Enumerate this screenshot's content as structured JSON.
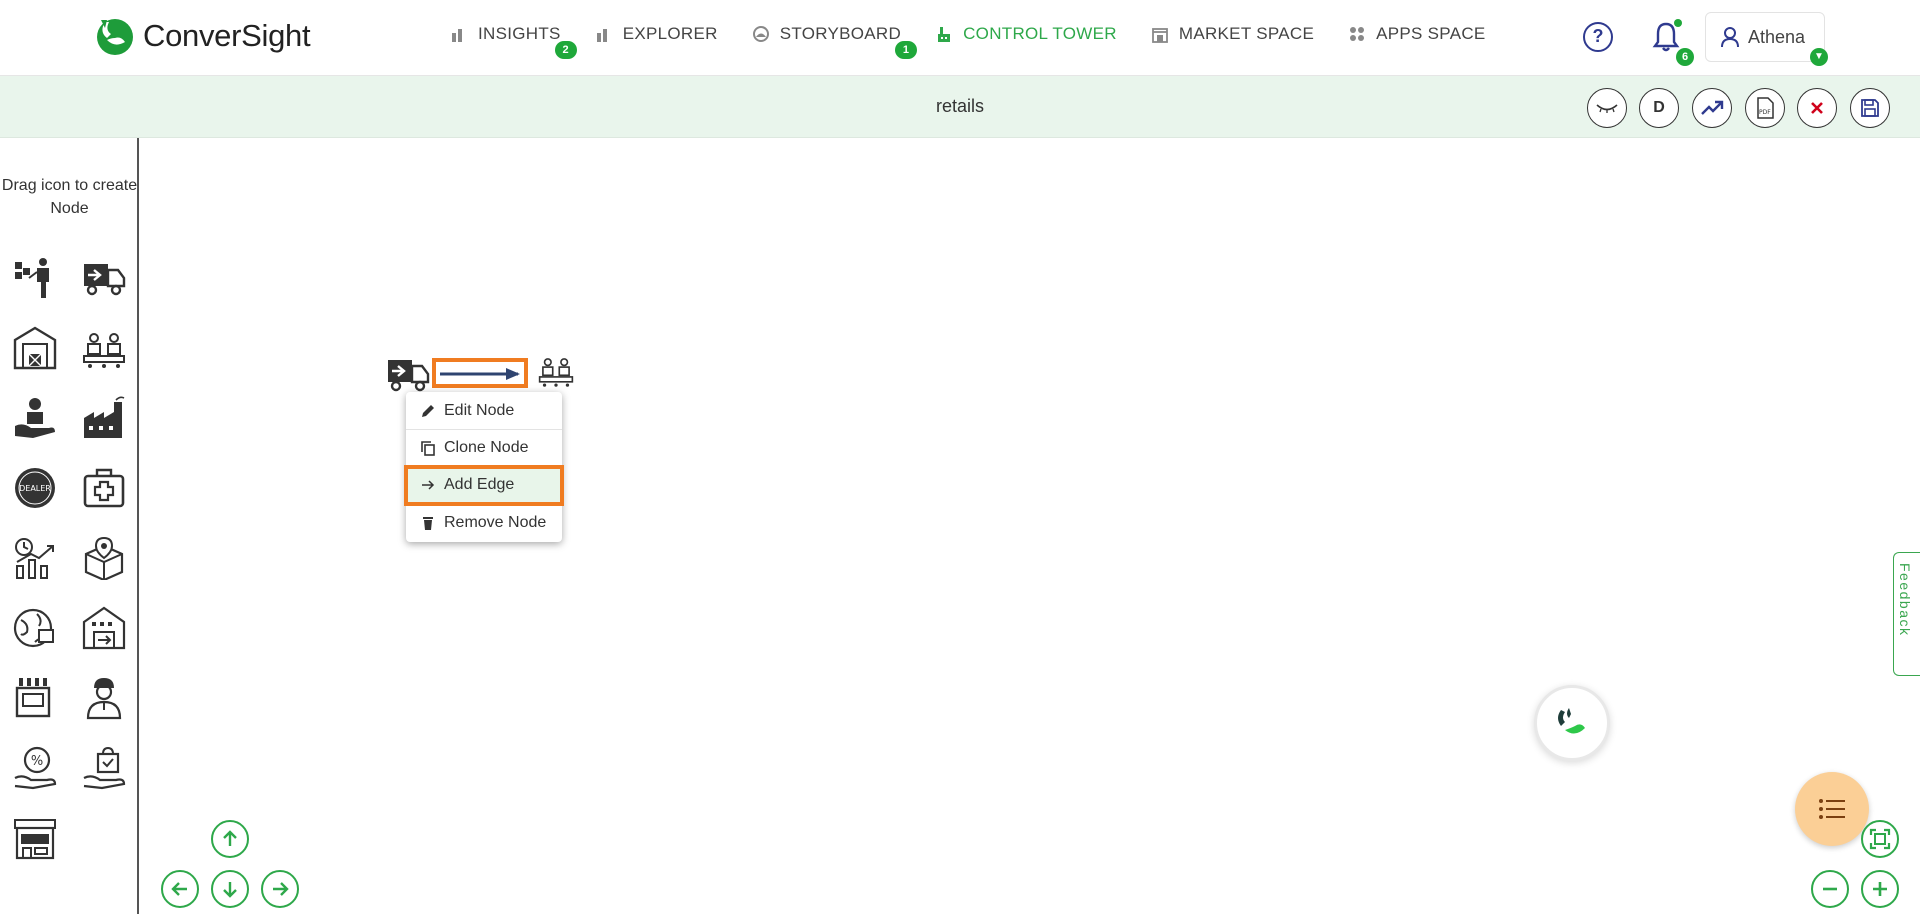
{
  "app": {
    "name": "ConverSight"
  },
  "nav": [
    {
      "label": "INSIGHTS",
      "badge": "2",
      "icon": "bar-chart-icon"
    },
    {
      "label": "EXPLORER",
      "badge": "",
      "icon": "bar-chart-icon"
    },
    {
      "label": "STORYBOARD",
      "badge": "1",
      "icon": "storyboard-icon"
    },
    {
      "label": "CONTROL TOWER",
      "badge": "",
      "icon": "tower-icon"
    },
    {
      "label": "MARKET SPACE",
      "badge": "",
      "icon": "market-icon"
    },
    {
      "label": "APPS SPACE",
      "badge": "",
      "icon": "grid-icon"
    }
  ],
  "header": {
    "help": "?",
    "notifications_count": "6",
    "user": "Athena"
  },
  "subheader": {
    "title": "retails",
    "tools": [
      {
        "name": "hide-icon"
      },
      {
        "name": "d-button",
        "label": "D"
      },
      {
        "name": "trend-icon"
      },
      {
        "name": "pdf-icon"
      },
      {
        "name": "close-icon"
      },
      {
        "name": "save-icon"
      }
    ]
  },
  "palette": {
    "title": "Drag icon to create Node",
    "icons": [
      "supplier-icon",
      "delivery-truck-icon",
      "warehouse-icon",
      "production-line-icon",
      "customer-care-icon",
      "factory-icon",
      "dealer-icon",
      "medical-kit-icon",
      "growth-icon",
      "package-location-icon",
      "global-logistics-icon",
      "distribution-center-icon",
      "machine-icon",
      "worker-icon",
      "discount-icon",
      "shopping-bag-icon",
      "store-icon"
    ]
  },
  "context_menu": {
    "items": [
      {
        "label": "Edit Node",
        "icon": "pencil-icon"
      },
      {
        "label": "Clone Node",
        "icon": "copy-icon"
      },
      {
        "label": "Add Edge",
        "icon": "arrow-right-icon"
      },
      {
        "label": "Remove Node",
        "icon": "trash-icon"
      }
    ]
  },
  "feedback": {
    "label": "Feedback"
  },
  "colors": {
    "accent": "#2ea84a",
    "highlight": "#f07c21",
    "subheader_bg": "#e9f5ec",
    "fab_bg": "#fbcf96"
  }
}
